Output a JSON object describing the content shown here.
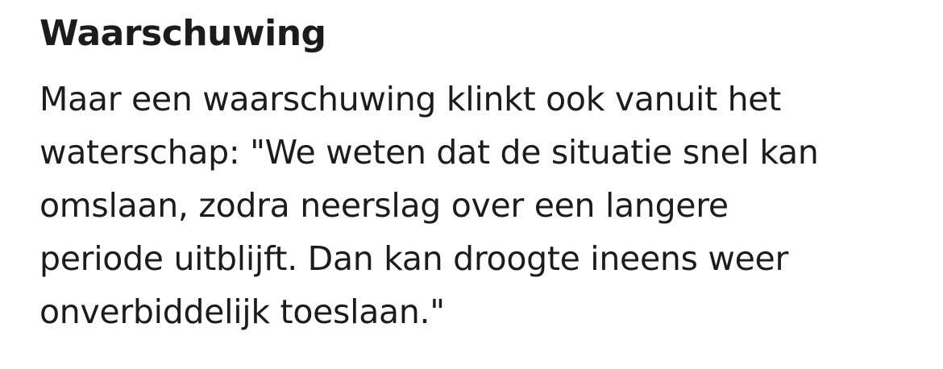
{
  "article": {
    "heading": "Waarschuwing",
    "paragraph_lines": [
      "Maar een waarschuwing klinkt ook vanuit het",
      "waterschap: \"We weten dat de situatie snel kan",
      "omslaan, zodra neerslag over een langere",
      "periode uitblijft. Dan kan droogte ineens weer",
      "onverbiddelijk toeslaan.\""
    ]
  }
}
